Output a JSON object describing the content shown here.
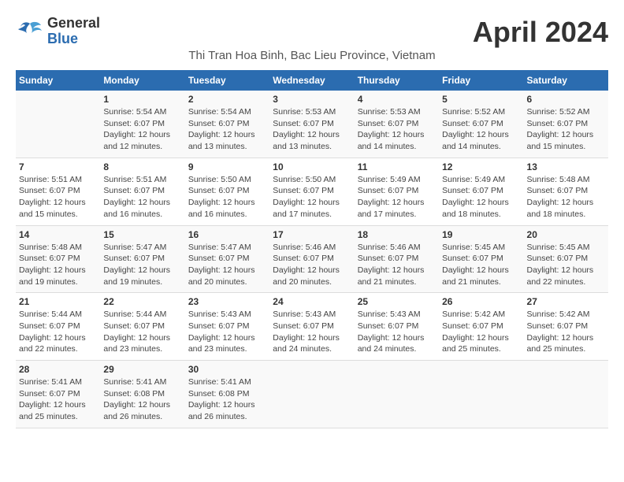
{
  "brand": {
    "general": "General",
    "blue": "Blue"
  },
  "title": "April 2024",
  "subtitle": "Thi Tran Hoa Binh, Bac Lieu Province, Vietnam",
  "weekdays": [
    "Sunday",
    "Monday",
    "Tuesday",
    "Wednesday",
    "Thursday",
    "Friday",
    "Saturday"
  ],
  "weeks": [
    [
      {
        "day": "",
        "info": ""
      },
      {
        "day": "1",
        "info": "Sunrise: 5:54 AM\nSunset: 6:07 PM\nDaylight: 12 hours\nand 12 minutes."
      },
      {
        "day": "2",
        "info": "Sunrise: 5:54 AM\nSunset: 6:07 PM\nDaylight: 12 hours\nand 13 minutes."
      },
      {
        "day": "3",
        "info": "Sunrise: 5:53 AM\nSunset: 6:07 PM\nDaylight: 12 hours\nand 13 minutes."
      },
      {
        "day": "4",
        "info": "Sunrise: 5:53 AM\nSunset: 6:07 PM\nDaylight: 12 hours\nand 14 minutes."
      },
      {
        "day": "5",
        "info": "Sunrise: 5:52 AM\nSunset: 6:07 PM\nDaylight: 12 hours\nand 14 minutes."
      },
      {
        "day": "6",
        "info": "Sunrise: 5:52 AM\nSunset: 6:07 PM\nDaylight: 12 hours\nand 15 minutes."
      }
    ],
    [
      {
        "day": "7",
        "info": "Sunrise: 5:51 AM\nSunset: 6:07 PM\nDaylight: 12 hours\nand 15 minutes."
      },
      {
        "day": "8",
        "info": "Sunrise: 5:51 AM\nSunset: 6:07 PM\nDaylight: 12 hours\nand 16 minutes."
      },
      {
        "day": "9",
        "info": "Sunrise: 5:50 AM\nSunset: 6:07 PM\nDaylight: 12 hours\nand 16 minutes."
      },
      {
        "day": "10",
        "info": "Sunrise: 5:50 AM\nSunset: 6:07 PM\nDaylight: 12 hours\nand 17 minutes."
      },
      {
        "day": "11",
        "info": "Sunrise: 5:49 AM\nSunset: 6:07 PM\nDaylight: 12 hours\nand 17 minutes."
      },
      {
        "day": "12",
        "info": "Sunrise: 5:49 AM\nSunset: 6:07 PM\nDaylight: 12 hours\nand 18 minutes."
      },
      {
        "day": "13",
        "info": "Sunrise: 5:48 AM\nSunset: 6:07 PM\nDaylight: 12 hours\nand 18 minutes."
      }
    ],
    [
      {
        "day": "14",
        "info": "Sunrise: 5:48 AM\nSunset: 6:07 PM\nDaylight: 12 hours\nand 19 minutes."
      },
      {
        "day": "15",
        "info": "Sunrise: 5:47 AM\nSunset: 6:07 PM\nDaylight: 12 hours\nand 19 minutes."
      },
      {
        "day": "16",
        "info": "Sunrise: 5:47 AM\nSunset: 6:07 PM\nDaylight: 12 hours\nand 20 minutes."
      },
      {
        "day": "17",
        "info": "Sunrise: 5:46 AM\nSunset: 6:07 PM\nDaylight: 12 hours\nand 20 minutes."
      },
      {
        "day": "18",
        "info": "Sunrise: 5:46 AM\nSunset: 6:07 PM\nDaylight: 12 hours\nand 21 minutes."
      },
      {
        "day": "19",
        "info": "Sunrise: 5:45 AM\nSunset: 6:07 PM\nDaylight: 12 hours\nand 21 minutes."
      },
      {
        "day": "20",
        "info": "Sunrise: 5:45 AM\nSunset: 6:07 PM\nDaylight: 12 hours\nand 22 minutes."
      }
    ],
    [
      {
        "day": "21",
        "info": "Sunrise: 5:44 AM\nSunset: 6:07 PM\nDaylight: 12 hours\nand 22 minutes."
      },
      {
        "day": "22",
        "info": "Sunrise: 5:44 AM\nSunset: 6:07 PM\nDaylight: 12 hours\nand 23 minutes."
      },
      {
        "day": "23",
        "info": "Sunrise: 5:43 AM\nSunset: 6:07 PM\nDaylight: 12 hours\nand 23 minutes."
      },
      {
        "day": "24",
        "info": "Sunrise: 5:43 AM\nSunset: 6:07 PM\nDaylight: 12 hours\nand 24 minutes."
      },
      {
        "day": "25",
        "info": "Sunrise: 5:43 AM\nSunset: 6:07 PM\nDaylight: 12 hours\nand 24 minutes."
      },
      {
        "day": "26",
        "info": "Sunrise: 5:42 AM\nSunset: 6:07 PM\nDaylight: 12 hours\nand 25 minutes."
      },
      {
        "day": "27",
        "info": "Sunrise: 5:42 AM\nSunset: 6:07 PM\nDaylight: 12 hours\nand 25 minutes."
      }
    ],
    [
      {
        "day": "28",
        "info": "Sunrise: 5:41 AM\nSunset: 6:07 PM\nDaylight: 12 hours\nand 25 minutes."
      },
      {
        "day": "29",
        "info": "Sunrise: 5:41 AM\nSunset: 6:08 PM\nDaylight: 12 hours\nand 26 minutes."
      },
      {
        "day": "30",
        "info": "Sunrise: 5:41 AM\nSunset: 6:08 PM\nDaylight: 12 hours\nand 26 minutes."
      },
      {
        "day": "",
        "info": ""
      },
      {
        "day": "",
        "info": ""
      },
      {
        "day": "",
        "info": ""
      },
      {
        "day": "",
        "info": ""
      }
    ]
  ]
}
